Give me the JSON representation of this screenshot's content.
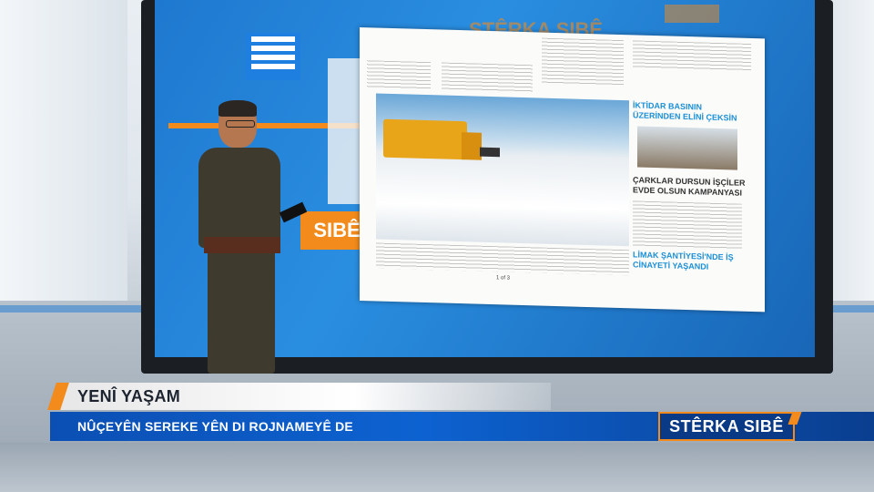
{
  "screen": {
    "bg_logo_text": "STÊRKA SIBÊ",
    "orange_tab_text": "SIBÊ",
    "newspaper": {
      "masthead": "...",
      "side_headlines": [
        "İKTİDAR BASININ ÜZERİNDEN ELİNİ ÇEKSİN",
        "ÇARKLAR DURSUN İŞÇİLER EVDE OLSUN KAMPANYASI",
        "LİMAK ŞANTİYESİ'NDE İŞ CİNAYETİ YAŞANDI"
      ],
      "page_number": "1 of 3"
    }
  },
  "lower_third": {
    "title": "YENÎ YAŞAM",
    "subtitle": "NÛÇEYÊN SEREKE YÊN DI ROJNAMEYÊ DE"
  },
  "channel_logo": {
    "text": "STÊRKA SIBÊ"
  },
  "colors": {
    "accent_orange": "#f28a1c",
    "bar_blue": "#0d62d1",
    "screen_blue": "#2a8ee0"
  }
}
